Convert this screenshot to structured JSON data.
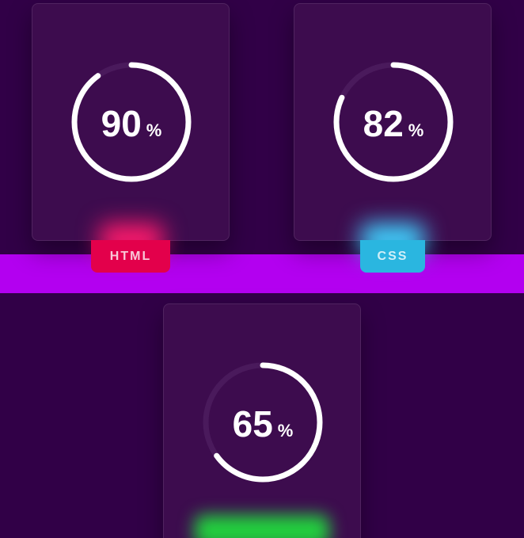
{
  "colors": {
    "background": "#310047",
    "band": "#b300f0",
    "card": "#3d0c4e",
    "ring_track": "#4a1a5c",
    "ring_fill": "#ffffff",
    "html_tag": "#e3004b",
    "css_tag": "#2ab6e0",
    "third_tag": "#22d03e"
  },
  "skills": [
    {
      "value": "90",
      "unit": "%",
      "label": "HTML",
      "percent": 90
    },
    {
      "value": "82",
      "unit": "%",
      "label": "CSS",
      "percent": 82
    },
    {
      "value": "65",
      "unit": "%",
      "label": "",
      "percent": 65
    }
  ]
}
